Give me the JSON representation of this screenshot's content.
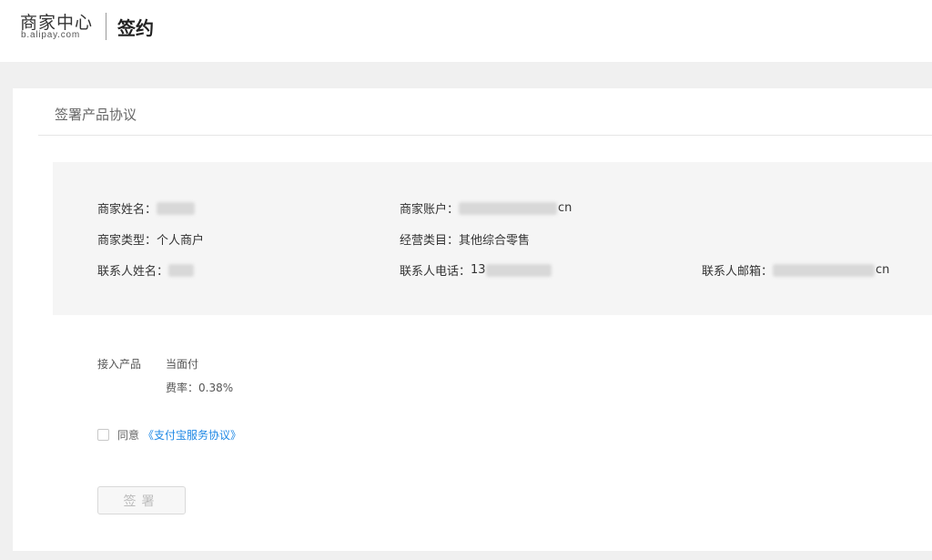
{
  "header": {
    "logo_text": "商家中心",
    "logo_domain": "b.alipay.com",
    "page_title": "签约"
  },
  "card": {
    "title": "签署产品协议"
  },
  "merchant_info": {
    "name_label": "商家姓名：",
    "account_label": "商家账户：",
    "account_suffix": "cn",
    "type_label": "商家类型：",
    "type_value": "个人商户",
    "category_label": "经营类目：",
    "category_value": "其他综合零售",
    "contact_name_label": "联系人姓名：",
    "contact_phone_label": "联系人电话：",
    "contact_phone_prefix": "13",
    "contact_email_label": "联系人邮箱：",
    "contact_email_suffix": "cn"
  },
  "product": {
    "label": "接入产品",
    "name": "当面付",
    "fee": "费率：0.38%"
  },
  "agreement": {
    "checked": false,
    "prefix": "同意",
    "link_text": "《支付宝服务协议》"
  },
  "sign_button": {
    "label": "签署"
  }
}
